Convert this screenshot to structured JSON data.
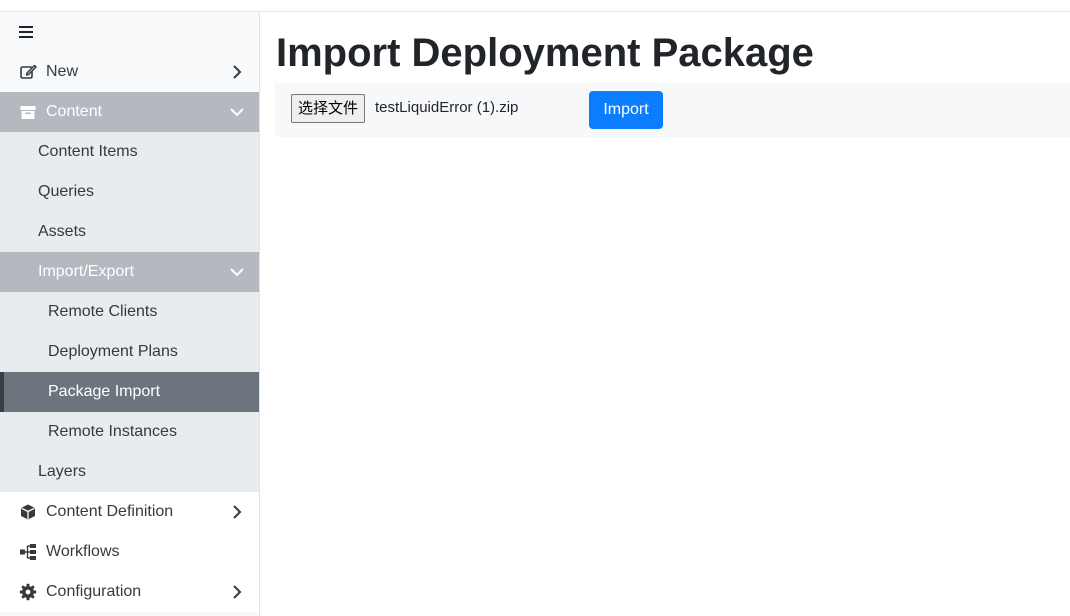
{
  "sidebar": {
    "items": {
      "new": "New",
      "content": "Content",
      "content_items": "Content Items",
      "queries": "Queries",
      "assets": "Assets",
      "import_export": "Import/Export",
      "remote_clients": "Remote Clients",
      "deployment_plans": "Deployment Plans",
      "package_import": "Package Import",
      "remote_instances": "Remote Instances",
      "layers": "Layers",
      "content_definition": "Content Definition",
      "workflows": "Workflows",
      "configuration": "Configuration"
    },
    "icons": {
      "menu": "hamburger-icon",
      "new": "edit-icon",
      "content": "archive-icon",
      "content_definition": "cube-icon",
      "workflows": "sitemap-icon",
      "configuration": "gear-icon"
    },
    "colors": {
      "expanded_bg": "#b3b9bf",
      "active_bg": "#6c757d",
      "sub_bg": "#e9ecef"
    }
  },
  "main": {
    "title": "Import Deployment Package",
    "file_input": {
      "button_label": "选择文件",
      "file_name": "testLiquidError (1).zip"
    },
    "import_button": "Import",
    "accent_color": "#0d7dff"
  }
}
